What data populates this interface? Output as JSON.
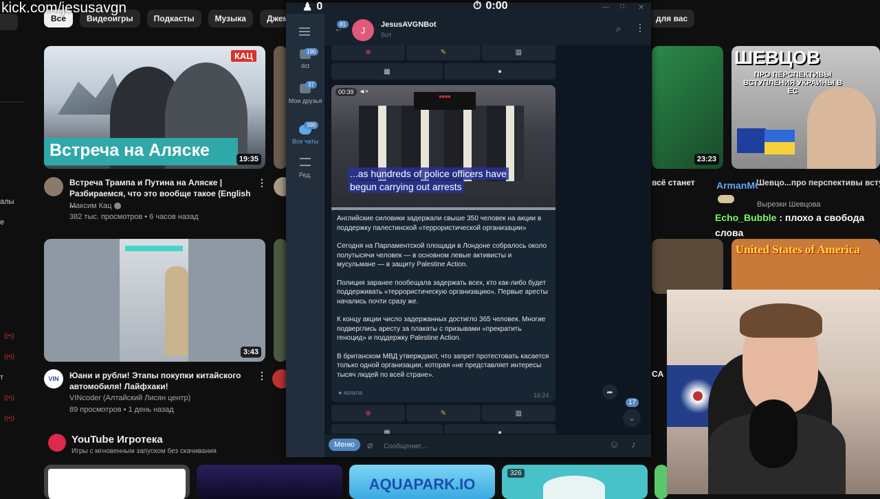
{
  "overlay": {
    "url": "kick.com/jesusavgn",
    "counter": "0",
    "timer": "0:00"
  },
  "youtube": {
    "chips": [
      "Все",
      "Видеоигры",
      "Подкасты",
      "Музыка",
      "Джемы"
    ],
    "chip_right": "для вас",
    "sidebar_fragments": [
      "алы",
      "е",
      "т"
    ],
    "videos": [
      {
        "title": "Встреча Трампа и Путина на Аляске | Разбираемся, что это вообще такое (English ...",
        "channel": "Максим Кац",
        "meta": "382 тыс. просмотров • 6 часов назад",
        "duration": "19:35",
        "thumb_text": "Встреча на Аляске",
        "thumb_badge": "КАЦ"
      },
      {
        "title": "Юани и рубли! Этапы покупки китайского автомобиля! Лайфхаки!",
        "channel": "VINcoder (Алтайский Лисян центр)",
        "meta": "89 просмотров • 1 день назад",
        "duration": "3:43"
      }
    ],
    "right_videos": [
      {
        "duration": "23:23",
        "title_fragment": "всё станет"
      },
      {
        "thumb_title": "ШЕВЦОВ",
        "thumb_sub": "ПРО ПЕРСПЕКТИВЫ ВСТУПЛЕНИЯ УКРАИНЫ В ЕС",
        "title_fragment": "Шевцо...про перспективы всту... Украины в ЕС",
        "channel": "Вырезки Шевцова"
      },
      {
        "thumb_title": "United States of America"
      }
    ],
    "right_fragment": "CA",
    "playables": {
      "title": "YouTube Игротека",
      "subtitle": "Игры с мгновенным запуском без скачивания",
      "cards": [
        "",
        "",
        "AQUAPARK.IO",
        ""
      ],
      "card_badge": "326"
    }
  },
  "stream_chat": [
    {
      "user": "ArmanMC",
      "text": "",
      "color": "#6aa8ff"
    },
    {
      "user": "Echo_Bubble",
      "text": " : плохо а свобода слова",
      "color": "#7bff6a"
    }
  ],
  "telegram": {
    "chat_title": "JesusAVGNBot",
    "chat_subtitle": "бот",
    "avatar_letter": "J",
    "back_badge": "81",
    "folders": [
      {
        "label": "dct",
        "badge": "190"
      },
      {
        "label": "Мои друзья",
        "badge": "37"
      },
      {
        "label": "Все чаты",
        "badge": "395"
      },
      {
        "label": "Ред.",
        "badge": ""
      }
    ],
    "video": {
      "time": "00:39",
      "caption_line1": "...as hundreds of police officers have",
      "caption_line2": "begun carrying out arrests",
      "progress": 0.0
    },
    "message_paragraphs": [
      "Английские силовики задержали свыше 350 человек на акции в поддержку палестинской «террористической организации»",
      "Сегодня на Парламентской площади в Лондоне собралось около полутысячи человек — в основном левые активисты и мусульмане — в защиту Palestine Action.",
      "Полиция заранее пообещала задержать всех, кто как-либо будет поддерживать «террористическую организацию». Первые аресты начались почти сразу же.",
      "К концу акции число задержанных достигло 365 человек. Многие подверглись аресту за плакаты с призывами «прекратить геноцид» и поддержку Palestine Action.",
      "В британском МВД утверждают, что запрет протестовать касается только одной организации, которая «не представляет интересы тысяч людей по всей стране»."
    ],
    "signature": "юлала",
    "msg_time": "16:24",
    "scroll_badge": "17",
    "menu_label": "Меню",
    "input_placeholder": "Сообщение..."
  },
  "colors": {
    "tg_accent": "#5288c1",
    "tg_bg": "#0e1621",
    "yt_bg": "#0f0f0f"
  }
}
